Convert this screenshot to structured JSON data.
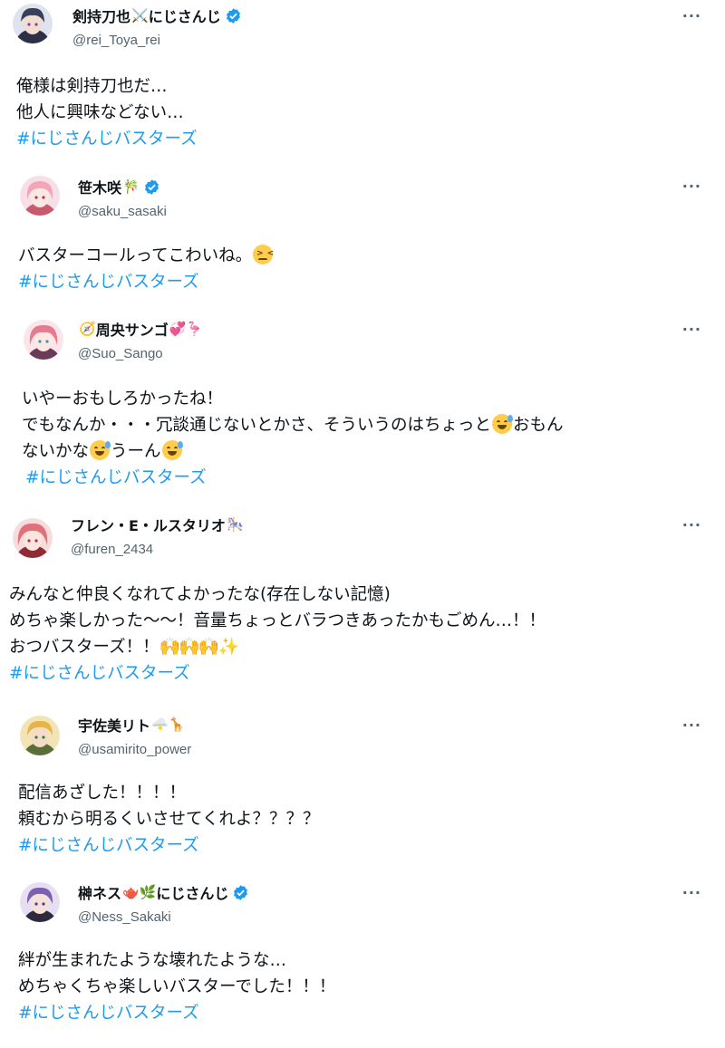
{
  "tweets": [
    {
      "name": "剣持刀也",
      "name_emoji": "⚔️",
      "name_suffix": "にじさんじ",
      "verified": true,
      "handle": "@rei_Toya_rei",
      "more": "···",
      "lines": [
        "俺様は剣持刀也だ…",
        "他人に興味などない…"
      ],
      "hashtag": "#にじさんじバスターズ",
      "avatar_colors": [
        "#3a3f5c",
        "#f2d5c8"
      ]
    },
    {
      "name": "笹木咲",
      "name_emoji": "🎋",
      "name_suffix": "",
      "verified": true,
      "handle": "@saku_sasaki",
      "more": "···",
      "lines": [
        "バスターコールってこわいね。"
      ],
      "line_emoji": "confounded",
      "hashtag": "#にじさんじバスターズ",
      "avatar_colors": [
        "#f3a6b8",
        "#fce4e8"
      ]
    },
    {
      "name_prefix_emoji": "🧭",
      "name": "周央サンゴ",
      "name_emoji": "💞🦩",
      "name_suffix": "",
      "verified": false,
      "handle": "@Suo_Sango",
      "more": "···",
      "lines": [
        "いやーおもしろかったね！",
        "でもなんか・・・冗談通じないとかさ、そういうのはちょっと",
        "おもん",
        "ないかな",
        "うーん"
      ],
      "hashtag": "#にじさんじバスターズ",
      "avatar_colors": [
        "#e8798f",
        "#fde2e6"
      ]
    },
    {
      "name": "フレン・E・ルスタリオ",
      "name_emoji": "🎠",
      "name_suffix": "",
      "verified": false,
      "handle": "@furen_2434",
      "more": "···",
      "lines": [
        "みんなと仲良くなれてよかったな(存在しない記憶)",
        "めちゃ楽しかった〜〜！音量ちょっとバラつきあったかもごめん…！！",
        "おつバスターズ！！"
      ],
      "hashtag": "#にじさんじバスターズ",
      "avatar_colors": [
        "#e0707a",
        "#f9d9d6"
      ]
    },
    {
      "name": "宇佐美リト",
      "name_emoji": "🌩️🦒",
      "name_suffix": "",
      "verified": false,
      "handle": "@usamirito_power",
      "more": "···",
      "lines": [
        "配信あざした！！！！",
        "頼むから明るくいさせてくれよ？？？？"
      ],
      "hashtag": "#にじさんじバスターズ",
      "avatar_colors": [
        "#e5b54a",
        "#6f8b4e"
      ]
    },
    {
      "name": "榊ネス",
      "name_emoji": "🫖🌿",
      "name_suffix": "にじさんじ",
      "verified": true,
      "handle": "@Ness_Sakaki",
      "more": "···",
      "lines": [
        "絆が生まれたような壊れたような…",
        "めちゃくちゃ楽しいバスターでした！！！"
      ],
      "hashtag": "#にじさんじバスターズ",
      "avatar_colors": [
        "#7b5fb0",
        "#e9e0f5"
      ]
    }
  ],
  "colors": {
    "hashtag": "#1d9bf0",
    "verified": "#1d9bf0",
    "handle": "#536471"
  }
}
